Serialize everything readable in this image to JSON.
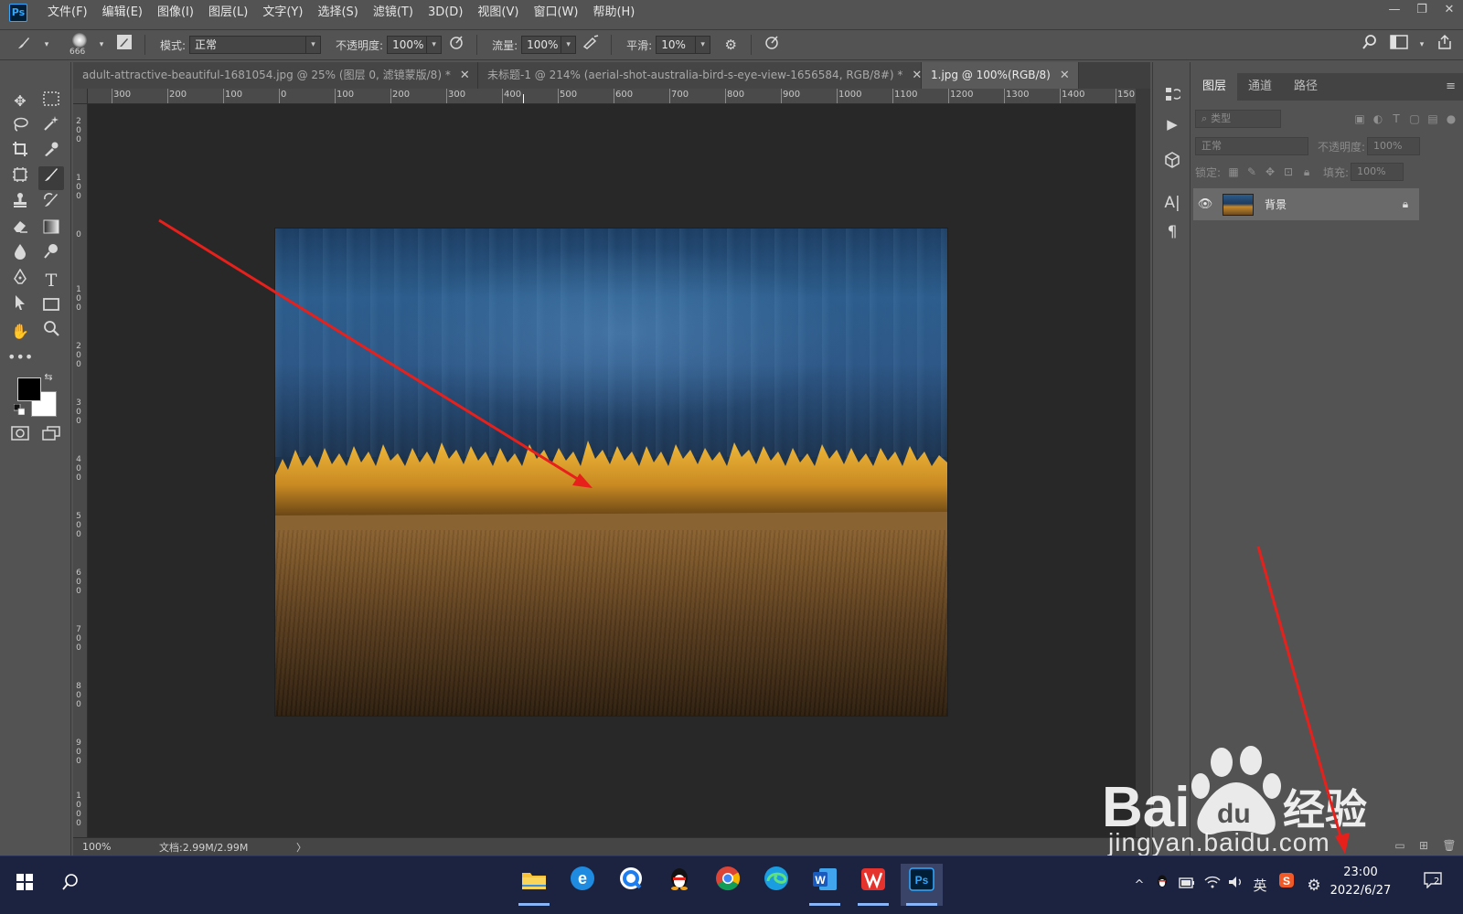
{
  "app": {
    "logo": "Ps",
    "accent": "#31a8ff"
  },
  "menu": [
    "文件(F)",
    "编辑(E)",
    "图像(I)",
    "图层(L)",
    "文字(Y)",
    "选择(S)",
    "滤镜(T)",
    "3D(D)",
    "视图(V)",
    "窗口(W)",
    "帮助(H)"
  ],
  "window_controls": {
    "minimize": "—",
    "restore": "❐",
    "close": "✕"
  },
  "options": {
    "brush_size": "666",
    "mode_label": "模式:",
    "mode_value": "正常",
    "opacity_label": "不透明度:",
    "opacity_value": "100%",
    "flow_label": "流量:",
    "flow_value": "100%",
    "smoothing_label": "平滑:",
    "smoothing_value": "10%"
  },
  "tabs": [
    {
      "title": "adult-attractive-beautiful-1681054.jpg  @  25%  (图层 0, 滤镜蒙版/8) *",
      "close": "✕"
    },
    {
      "title": "未标题-1 @ 214% (aerial-shot-australia-bird-s-eye-view-1656584, RGB/8#) *",
      "close": "✕"
    },
    {
      "title": "1.jpg @ 100%(RGB/8)",
      "close": "✕"
    }
  ],
  "ruler_h": [
    "300",
    "200",
    "100",
    "0",
    "100",
    "200",
    "300",
    "400",
    "500",
    "600",
    "700",
    "800",
    "900",
    "1000",
    "1100",
    "1200",
    "1300",
    "1400",
    "150"
  ],
  "ruler_v": [
    "200",
    "100",
    "0",
    "100",
    "200",
    "300",
    "400",
    "500",
    "600",
    "700",
    "800",
    "900",
    "1000"
  ],
  "status": {
    "zoom": "100%",
    "doc": "文档:2.99M/2.99M",
    "arrow": "〉"
  },
  "panel": {
    "tabs": [
      "图层",
      "通道",
      "路径"
    ],
    "filter_placeholder": "类型",
    "blend_mode": "正常",
    "opacity_label": "不透明度:",
    "opacity_value": "100%",
    "lock_label": "锁定:",
    "fill_label": "填充:",
    "fill_value": "100%"
  },
  "layers": [
    {
      "name": "背景",
      "visible": true,
      "locked": true
    }
  ],
  "taskbar": {
    "apps": [
      "file-explorer",
      "ie-browser",
      "qq-browser",
      "qq",
      "chrome",
      "edge",
      "word",
      "wps",
      "photoshop"
    ],
    "tray_lang": "英",
    "time": "23:00",
    "date": "2022/6/27",
    "notification_count": "2"
  },
  "watermark": {
    "brand": "Bai",
    "brand2": "经验",
    "url": "jingyan.baidu.com"
  },
  "annotation_color": "#e8201c"
}
